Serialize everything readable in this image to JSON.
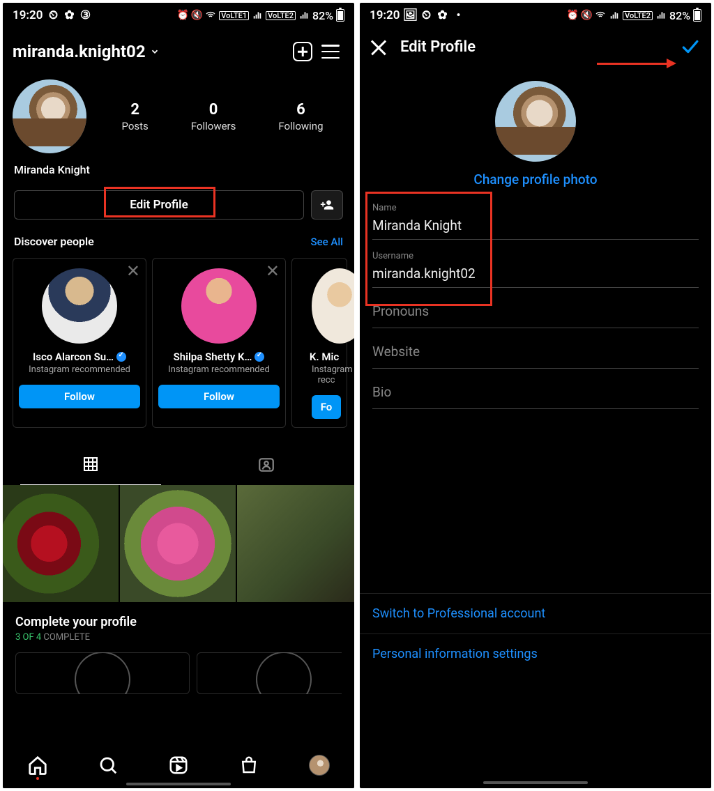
{
  "statusbar": {
    "time": "19:20",
    "battery": "82%"
  },
  "left": {
    "header": {
      "username": "miranda.knight02"
    },
    "stats": {
      "posts_num": "2",
      "posts_label": "Posts",
      "followers_num": "0",
      "followers_label": "Followers",
      "following_num": "6",
      "following_label": "Following"
    },
    "display_name": "Miranda Knight",
    "edit_profile_label": "Edit Profile",
    "discover": {
      "title": "Discover people",
      "see_all": "See All",
      "cards": [
        {
          "name": "Isco Alarcon Su…",
          "sub": "Instagram recommended",
          "follow": "Follow"
        },
        {
          "name": "Shilpa Shetty K…",
          "sub": "Instagram recommended",
          "follow": "Follow"
        },
        {
          "name": "K. Mic",
          "sub": "Instagram recc",
          "follow": "Fo"
        }
      ]
    },
    "complete": {
      "title": "Complete your profile",
      "sub_green": "3 OF 4",
      "sub_grey": " COMPLETE"
    }
  },
  "right": {
    "title": "Edit Profile",
    "change_photo": "Change profile photo",
    "fields": {
      "name_label": "Name",
      "name_value": "Miranda Knight",
      "username_label": "Username",
      "username_value": "miranda.knight02",
      "pronouns": "Pronouns",
      "website": "Website",
      "bio": "Bio"
    },
    "switch_pro": "Switch to Professional account",
    "personal_info": "Personal information settings"
  }
}
